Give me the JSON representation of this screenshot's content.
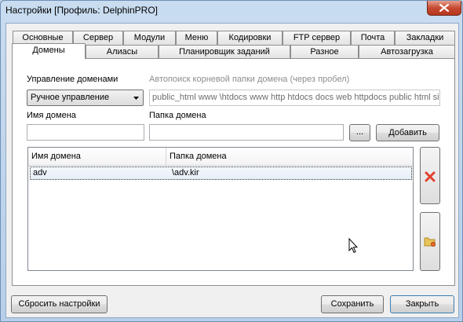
{
  "window": {
    "title": "Настройки [Профиль: DelphinPRO]"
  },
  "tabs": {
    "row1": [
      "Основные",
      "Сервер",
      "Модули",
      "Меню",
      "Кодировки",
      "FTP сервер",
      "Почта",
      "Закладки"
    ],
    "row2": [
      "Домены",
      "Алиасы",
      "Планировщик заданий",
      "Разное",
      "Автозагрузка"
    ],
    "active": "Домены"
  },
  "domains": {
    "manage_label": "Управление доменами",
    "manage_value": "Ручное управление",
    "autosearch_label": "Автопоиск корневой папки домена (через пробел)",
    "autosearch_value": "public_html www \\htdocs www http htdocs docs web httpdocs public html site",
    "domain_name_label": "Имя домена",
    "domain_name_value": "",
    "domain_folder_label": "Папка домена",
    "domain_folder_value": "",
    "browse_label": "...",
    "add_label": "Добавить",
    "list_headers": [
      "Имя домена",
      "Папка домена"
    ],
    "rows": [
      {
        "name": "adv",
        "folder": "\\adv.kir"
      }
    ]
  },
  "footer": {
    "reset_label": "Сбросить настройки",
    "save_label": "Сохранить",
    "close_label": "Закрыть"
  },
  "icons": {
    "delete": "red-x-icon",
    "folder": "folder-icon"
  },
  "colors": {
    "title_bar": "#c9dcf0",
    "close_button": "#c44a31",
    "delete_icon": "#e2412c",
    "folder_icon": "#e8c45a"
  }
}
